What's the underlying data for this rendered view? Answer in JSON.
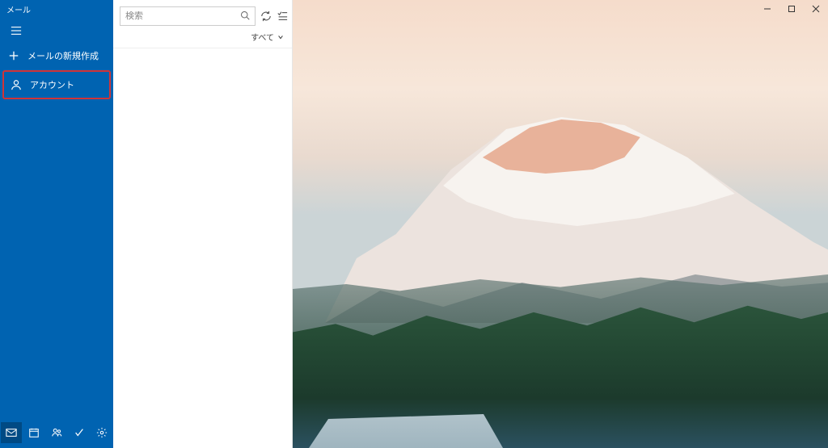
{
  "app": {
    "title": "メール"
  },
  "sidebar": {
    "compose_label": "メールの新規作成",
    "account_label": "アカウント"
  },
  "search": {
    "placeholder": "検索"
  },
  "filter": {
    "all_label": "すべて"
  }
}
